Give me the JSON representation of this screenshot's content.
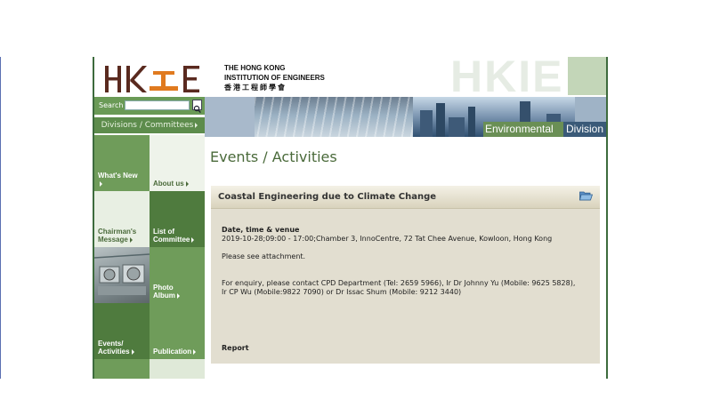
{
  "header": {
    "logo_letters": "HKIE",
    "org_name_line1": "THE HONG KONG",
    "org_name_line2": "INSTITUTION OF ENGINEERS",
    "org_name_chinese": "香港工程師學會",
    "watermark": "HKIE"
  },
  "search": {
    "label": "Search",
    "value": "",
    "button_icon": "magnifier-icon"
  },
  "divisions_menu": {
    "label": "Divisions / Committees"
  },
  "banner": {
    "caption_environmental": "Environmental",
    "caption_division": "Division"
  },
  "nav": {
    "whats_new": "What's New",
    "about_us": "About us",
    "chairmans_message_line1": "Chairman's",
    "chairmans_message_line2": "Message",
    "list_of_committee_line1": "List of",
    "list_of_committee_line2": "Committee",
    "photo_album_line1": "Photo",
    "photo_album_line2": "Album",
    "events_activities_line1": "Events/",
    "events_activities_line2": "Activities",
    "publication": "Publication"
  },
  "main": {
    "page_title": "Events / Activities",
    "event": {
      "title": "Coastal Engineering due to Climate Change",
      "date_label": "Date, time & venue",
      "date_value": "2019-10-28;09:00 - 17:00;Chamber 3, InnoCentre, 72 Tat Chee Avenue, Kowloon, Hong Kong",
      "note": "Please see attachment.",
      "enquiry": "For enquiry, please contact CPD Department (Tel: 2659 5966), Ir Dr Johnny Yu (Mobile: 9625 5828), Ir CP Wu (Mobile:9822 7090) or Dr Issac Shum (Mobile: 9212 3440)",
      "report_label": "Report"
    }
  },
  "colors": {
    "brand_green": "#5d8c4c",
    "dark_green": "#4a6a3a",
    "logo_maroon": "#5a2a1f",
    "logo_orange": "#e07a1f",
    "card_bg": "#e2ded0"
  }
}
